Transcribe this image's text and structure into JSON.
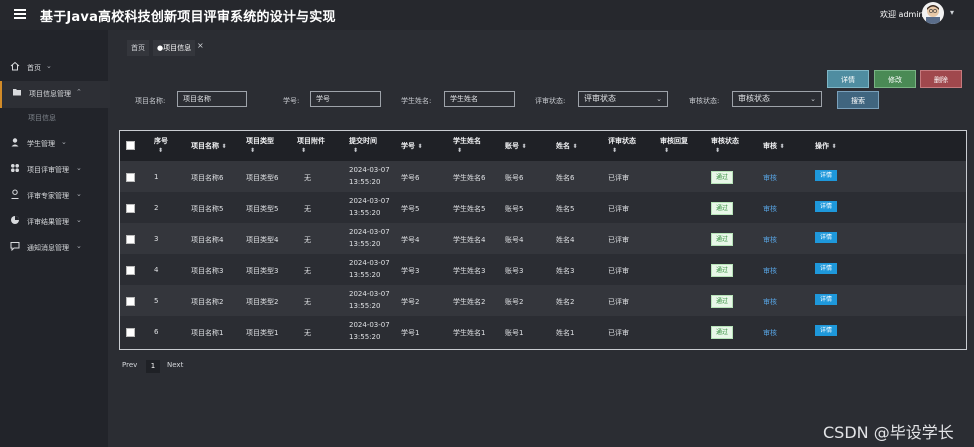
{
  "header": {
    "title": "基于Java高校科技创新项目评审系统的设计与实现",
    "welcome": "欢迎 admin"
  },
  "sidebar": {
    "items": [
      {
        "label": "首页",
        "icon": "home-icon"
      },
      {
        "label": "项目信息管理",
        "icon": "folder-icon"
      },
      {
        "label": "学生管理",
        "icon": "user-icon"
      },
      {
        "label": "项目评审管理",
        "icon": "grid-icon"
      },
      {
        "label": "评审专家管理",
        "icon": "person-icon"
      },
      {
        "label": "评审结果管理",
        "icon": "chart-icon"
      },
      {
        "label": "通知消息管理",
        "icon": "message-icon"
      }
    ],
    "sub_item": "项目信息"
  },
  "tabs": {
    "home": "首页",
    "current": "●项目信息"
  },
  "filters": {
    "project_name_label": "项目名称:",
    "project_name_value": "项目名称",
    "student_no_label": "学号:",
    "student_no_value": "学号",
    "student_name_label": "学生姓名:",
    "student_name_value": "学生姓名",
    "review_status_label": "评审状态:",
    "review_status_value": "评审状态",
    "audit_status_label": "审核状态:",
    "audit_status_value": "审核状态"
  },
  "actions": {
    "detail": "详情",
    "edit": "修改",
    "delete": "删除",
    "search": "搜索"
  },
  "table": {
    "headers": [
      "序号",
      "项目名称",
      "项目类型",
      "项目附件",
      "提交时间",
      "学号",
      "学生姓名",
      "账号",
      "姓名",
      "评审状态",
      "审核回复",
      "审核状态",
      "审核",
      "操作"
    ],
    "rows": [
      {
        "no": "1",
        "name": "项目名称6",
        "type": "项目类型6",
        "attach": "无",
        "date": "2024-03-07",
        "time": "13:55:20",
        "sno": "学号6",
        "sname": "学生姓名6",
        "account": "账号6",
        "person": "姓名6",
        "review": "已评审",
        "reply": "",
        "status": "通过",
        "audit": "审核",
        "op": "详情"
      },
      {
        "no": "2",
        "name": "项目名称5",
        "type": "项目类型5",
        "attach": "无",
        "date": "2024-03-07",
        "time": "13:55:20",
        "sno": "学号5",
        "sname": "学生姓名5",
        "account": "账号5",
        "person": "姓名5",
        "review": "已评审",
        "reply": "",
        "status": "通过",
        "audit": "审核",
        "op": "详情"
      },
      {
        "no": "3",
        "name": "项目名称4",
        "type": "项目类型4",
        "attach": "无",
        "date": "2024-03-07",
        "time": "13:55:20",
        "sno": "学号4",
        "sname": "学生姓名4",
        "account": "账号4",
        "person": "姓名4",
        "review": "已评审",
        "reply": "",
        "status": "通过",
        "audit": "审核",
        "op": "详情"
      },
      {
        "no": "4",
        "name": "项目名称3",
        "type": "项目类型3",
        "attach": "无",
        "date": "2024-03-07",
        "time": "13:55:20",
        "sno": "学号3",
        "sname": "学生姓名3",
        "account": "账号3",
        "person": "姓名3",
        "review": "已评审",
        "reply": "",
        "status": "通过",
        "audit": "审核",
        "op": "详情"
      },
      {
        "no": "5",
        "name": "项目名称2",
        "type": "项目类型2",
        "attach": "无",
        "date": "2024-03-07",
        "time": "13:55:20",
        "sno": "学号2",
        "sname": "学生姓名2",
        "account": "账号2",
        "person": "姓名2",
        "review": "已评审",
        "reply": "",
        "status": "通过",
        "audit": "审核",
        "op": "详情"
      },
      {
        "no": "6",
        "name": "项目名称1",
        "type": "项目类型1",
        "attach": "无",
        "date": "2024-03-07",
        "time": "13:55:20",
        "sno": "学号1",
        "sname": "学生姓名1",
        "account": "账号1",
        "person": "姓名1",
        "review": "已评审",
        "reply": "",
        "status": "通过",
        "audit": "审核",
        "op": "详情"
      }
    ]
  },
  "pagination": {
    "prev": "Prev",
    "current": "1",
    "next": "Next"
  },
  "watermark": "CSDN @毕设学长"
}
